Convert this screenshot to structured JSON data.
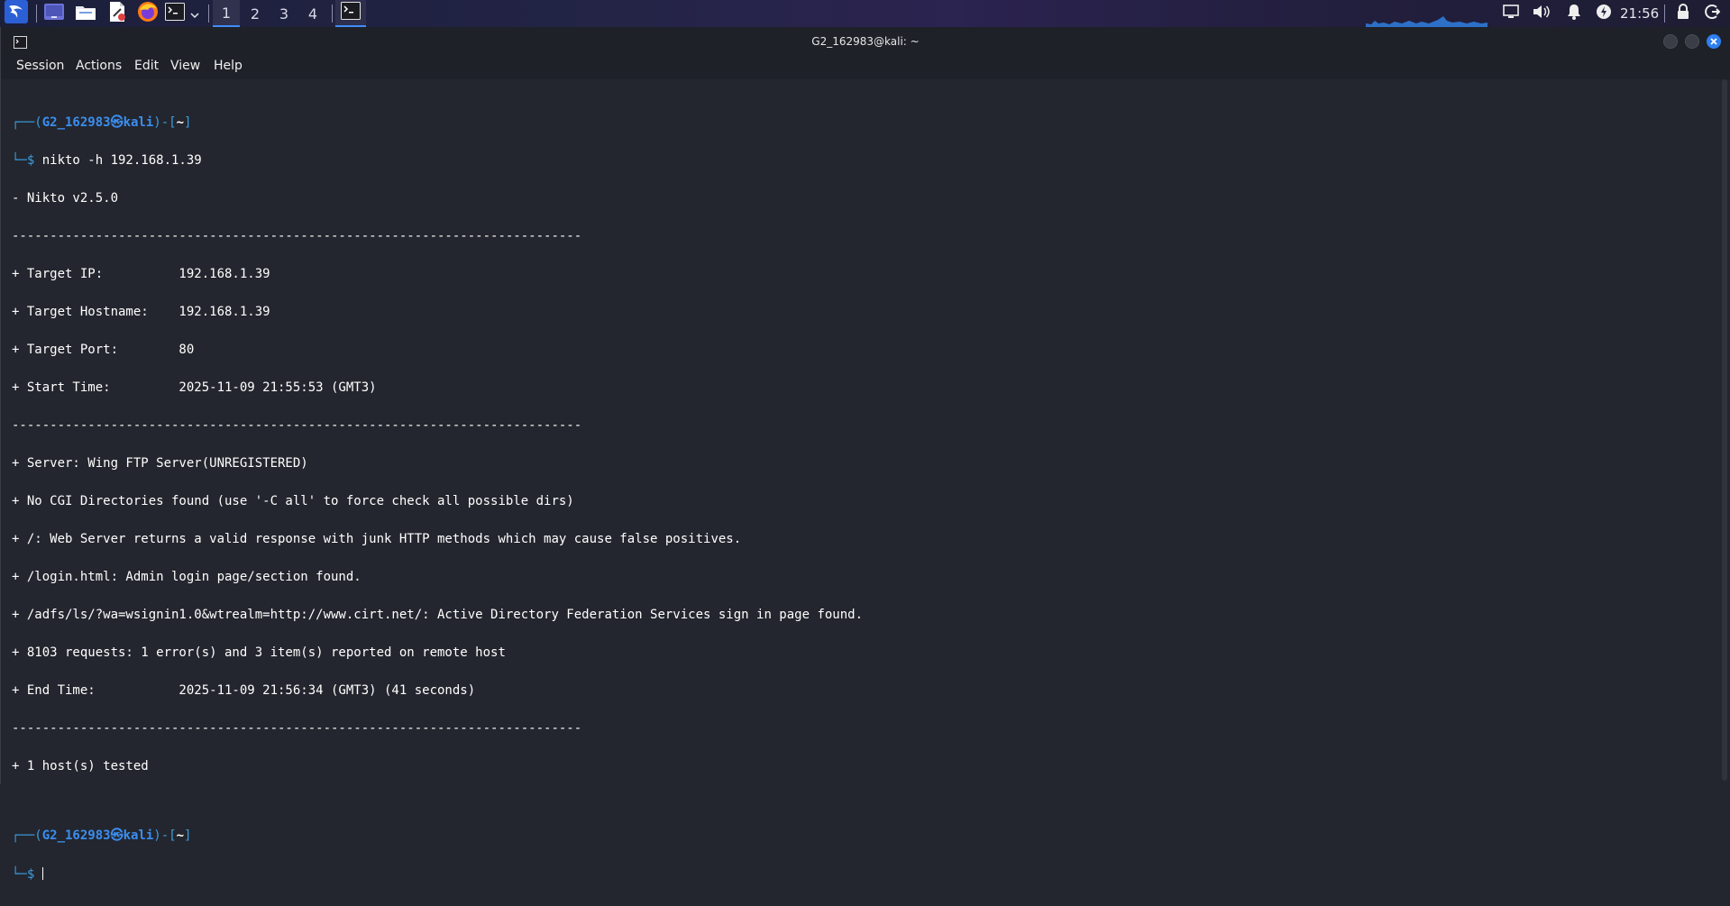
{
  "panel": {
    "workspaces": [
      "1",
      "2",
      "3",
      "4"
    ],
    "active_workspace": "1",
    "clock": "21:56",
    "icons": [
      "kali-menu-icon",
      "desktop-icon",
      "file-manager-icon",
      "text-editor-icon",
      "firefox-icon",
      "terminal-icon",
      "chevron-down-icon",
      "terminal-task-icon",
      "display-icon",
      "volume-icon",
      "bell-icon",
      "power-manager-icon",
      "lock-icon",
      "logout-icon"
    ]
  },
  "window": {
    "title": "G2_162983@kali: ~",
    "menu": [
      "Session",
      "Actions",
      "Edit",
      "View",
      "Help"
    ]
  },
  "terminal": {
    "prompt1": {
      "open": "┌──(",
      "user": "G2_162983㉿kali",
      "mid": ")-[",
      "dir": "~",
      "close": "]",
      "lead": "└─$ ",
      "command": "nikto -h 192.168.1.39"
    },
    "output": [
      "- Nikto v2.5.0",
      "---------------------------------------------------------------------------",
      "+ Target IP:          192.168.1.39",
      "+ Target Hostname:    192.168.1.39",
      "+ Target Port:        80",
      "+ Start Time:         2025-11-09 21:55:53 (GMT3)",
      "---------------------------------------------------------------------------",
      "+ Server: Wing FTP Server(UNREGISTERED)",
      "+ No CGI Directories found (use '-C all' to force check all possible dirs)",
      "+ /: Web Server returns a valid response with junk HTTP methods which may cause false positives.",
      "+ /login.html: Admin login page/section found.",
      "+ /adfs/ls/?wa=wsignin1.0&wtrealm=http://www.cirt.net/: Active Directory Federation Services sign in page found.",
      "+ 8103 requests: 1 error(s) and 3 item(s) reported on remote host",
      "+ End Time:           2025-11-09 21:56:34 (GMT3) (41 seconds)",
      "---------------------------------------------------------------------------",
      "+ 1 host(s) tested"
    ],
    "prompt2": {
      "open": "┌──(",
      "user": "G2_162983㉿kali",
      "mid": ")-[",
      "dir": "~",
      "close": "]",
      "lead": "└─$ "
    }
  },
  "colors": {
    "background": "#23262e",
    "prompt_blue": "#3b8ef0",
    "accent": "#3f8cff",
    "close_button": "#2f7ff0"
  }
}
